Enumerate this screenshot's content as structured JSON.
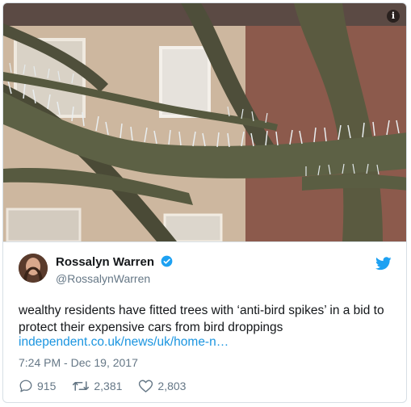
{
  "tweet": {
    "display_name": "Rossalyn Warren",
    "handle": "@RossalynWarren",
    "text": "wealthy residents have fitted trees with ‘anti-bird spikes’ in a bid to protect their expensive cars from bird droppings",
    "link": "independent.co.uk/news/uk/home-n…",
    "timestamp": "7:24 PM - Dec 19, 2017",
    "replies": "915",
    "retweets": "2,381",
    "likes": "2,803"
  },
  "icons": {
    "info": "info-icon",
    "verified": "verified-badge-icon",
    "brand": "twitter-bird-icon",
    "reply": "reply-icon",
    "retweet": "retweet-icon",
    "like": "heart-icon"
  },
  "colors": {
    "accent": "#1da1f2",
    "link": "#1b95e0",
    "muted": "#657786",
    "text": "#14171a"
  }
}
